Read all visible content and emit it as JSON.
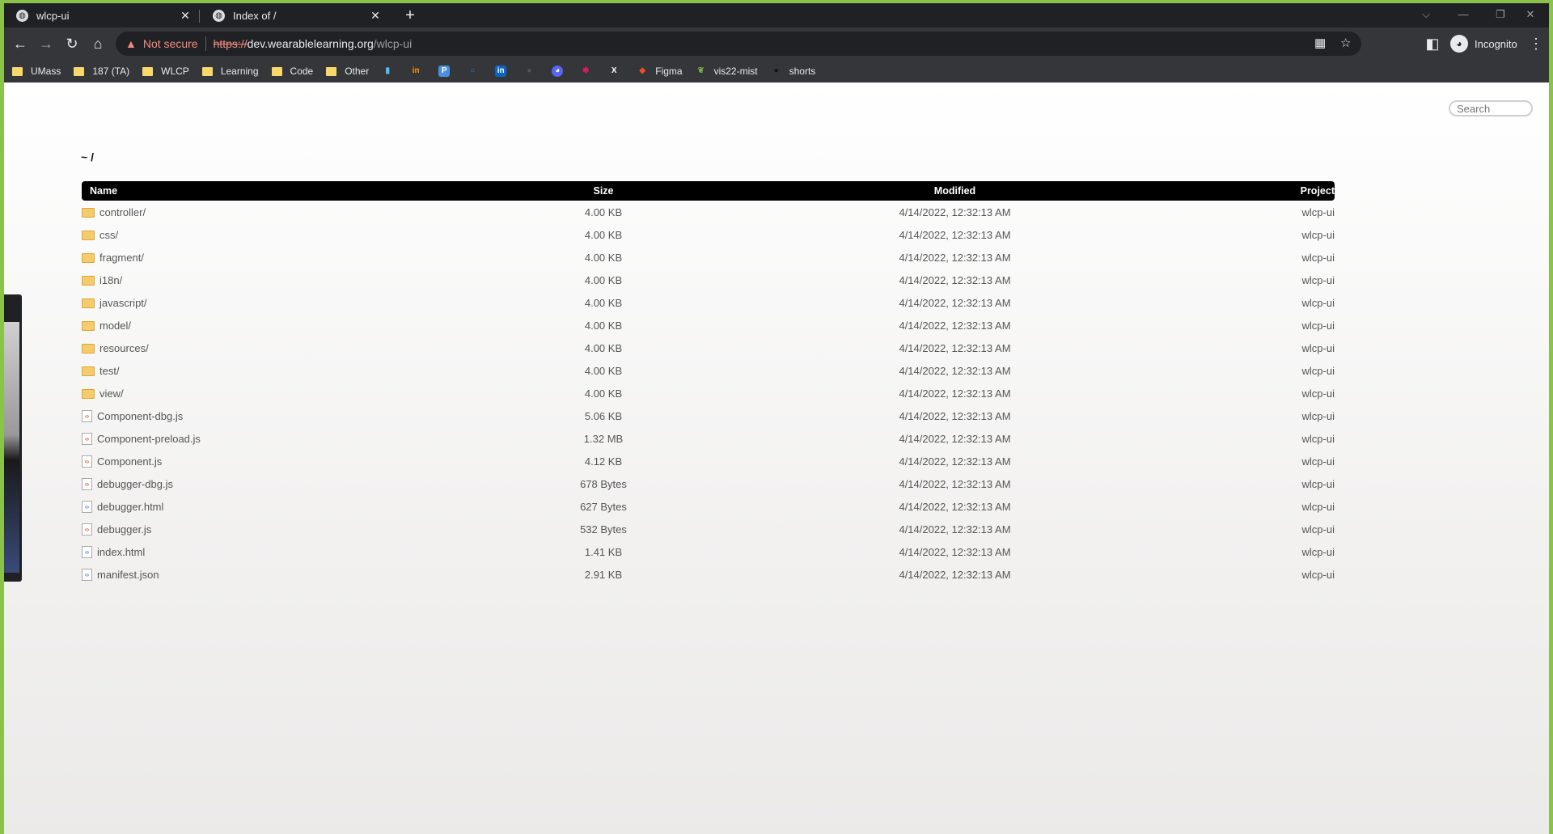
{
  "tabs": [
    {
      "title": "wlcp-ui",
      "close": "✕"
    },
    {
      "title": "Index of /",
      "close": "✕"
    }
  ],
  "new_tab_label": "+",
  "window_controls": {
    "dropdown": "⌵",
    "minimize": "—",
    "restore": "❐",
    "close": "✕"
  },
  "toolbar": {
    "back": "←",
    "forward": "→",
    "reload": "↻",
    "home": "⌂",
    "security_warning": "Not secure",
    "url_scheme": "https://",
    "url_host": "dev.wearablelearning.org",
    "url_path": "/wlcp-ui",
    "profile": "Incognito",
    "menu": "⋮"
  },
  "bookmarks": [
    {
      "label": "UMass",
      "type": "folder"
    },
    {
      "label": "187 (TA)",
      "type": "folder"
    },
    {
      "label": "WLCP",
      "type": "folder"
    },
    {
      "label": "Learning",
      "type": "folder"
    },
    {
      "label": "Code",
      "type": "folder"
    },
    {
      "label": "Other",
      "type": "folder"
    },
    {
      "label": "",
      "type": "icon",
      "icon": "bar-chart-icon"
    },
    {
      "label": "",
      "type": "icon",
      "icon": "in-icon"
    },
    {
      "label": "",
      "type": "icon",
      "icon": "p-icon"
    },
    {
      "label": "",
      "type": "icon",
      "icon": "ring-icon"
    },
    {
      "label": "",
      "type": "icon",
      "icon": "linkedin-icon"
    },
    {
      "label": "",
      "type": "icon",
      "icon": "github-icon"
    },
    {
      "label": "",
      "type": "icon",
      "icon": "discord-icon"
    },
    {
      "label": "",
      "type": "icon",
      "icon": "slack-icon"
    },
    {
      "label": "",
      "type": "icon",
      "icon": "x-icon"
    },
    {
      "label": "Figma",
      "type": "icon",
      "icon": "figma-icon"
    },
    {
      "label": "vis22-mist",
      "type": "icon",
      "icon": "leaf-icon"
    },
    {
      "label": "shorts",
      "type": "icon",
      "icon": "dot-icon"
    }
  ],
  "page": {
    "search_placeholder": "Search",
    "breadcrumb": "~ /",
    "columns": {
      "name": "Name",
      "size": "Size",
      "modified": "Modified",
      "project": "Project"
    },
    "files": [
      {
        "name": "controller/",
        "kind": "folder",
        "size": "4.00 KB",
        "modified": "4/14/2022, 12:32:13 AM",
        "project": "wlcp-ui"
      },
      {
        "name": "css/",
        "kind": "folder",
        "size": "4.00 KB",
        "modified": "4/14/2022, 12:32:13 AM",
        "project": "wlcp-ui"
      },
      {
        "name": "fragment/",
        "kind": "folder",
        "size": "4.00 KB",
        "modified": "4/14/2022, 12:32:13 AM",
        "project": "wlcp-ui"
      },
      {
        "name": "i18n/",
        "kind": "folder",
        "size": "4.00 KB",
        "modified": "4/14/2022, 12:32:13 AM",
        "project": "wlcp-ui"
      },
      {
        "name": "javascript/",
        "kind": "folder",
        "size": "4.00 KB",
        "modified": "4/14/2022, 12:32:13 AM",
        "project": "wlcp-ui"
      },
      {
        "name": "model/",
        "kind": "folder",
        "size": "4.00 KB",
        "modified": "4/14/2022, 12:32:13 AM",
        "project": "wlcp-ui"
      },
      {
        "name": "resources/",
        "kind": "folder",
        "size": "4.00 KB",
        "modified": "4/14/2022, 12:32:13 AM",
        "project": "wlcp-ui"
      },
      {
        "name": "test/",
        "kind": "folder",
        "size": "4.00 KB",
        "modified": "4/14/2022, 12:32:13 AM",
        "project": "wlcp-ui"
      },
      {
        "name": "view/",
        "kind": "folder",
        "size": "4.00 KB",
        "modified": "4/14/2022, 12:32:13 AM",
        "project": "wlcp-ui"
      },
      {
        "name": "Component-dbg.js",
        "kind": "js",
        "size": "5.06 KB",
        "modified": "4/14/2022, 12:32:13 AM",
        "project": "wlcp-ui"
      },
      {
        "name": "Component-preload.js",
        "kind": "js",
        "size": "1.32 MB",
        "modified": "4/14/2022, 12:32:13 AM",
        "project": "wlcp-ui"
      },
      {
        "name": "Component.js",
        "kind": "js",
        "size": "4.12 KB",
        "modified": "4/14/2022, 12:32:13 AM",
        "project": "wlcp-ui"
      },
      {
        "name": "debugger-dbg.js",
        "kind": "js",
        "size": "678 Bytes",
        "modified": "4/14/2022, 12:32:13 AM",
        "project": "wlcp-ui"
      },
      {
        "name": "debugger.html",
        "kind": "html",
        "size": "627 Bytes",
        "modified": "4/14/2022, 12:32:13 AM",
        "project": "wlcp-ui"
      },
      {
        "name": "debugger.js",
        "kind": "js",
        "size": "532 Bytes",
        "modified": "4/14/2022, 12:32:13 AM",
        "project": "wlcp-ui"
      },
      {
        "name": "index.html",
        "kind": "html",
        "size": "1.41 KB",
        "modified": "4/14/2022, 12:32:13 AM",
        "project": "wlcp-ui"
      },
      {
        "name": "manifest.json",
        "kind": "html",
        "size": "2.91 KB",
        "modified": "4/14/2022, 12:32:13 AM",
        "project": "wlcp-ui"
      }
    ]
  }
}
